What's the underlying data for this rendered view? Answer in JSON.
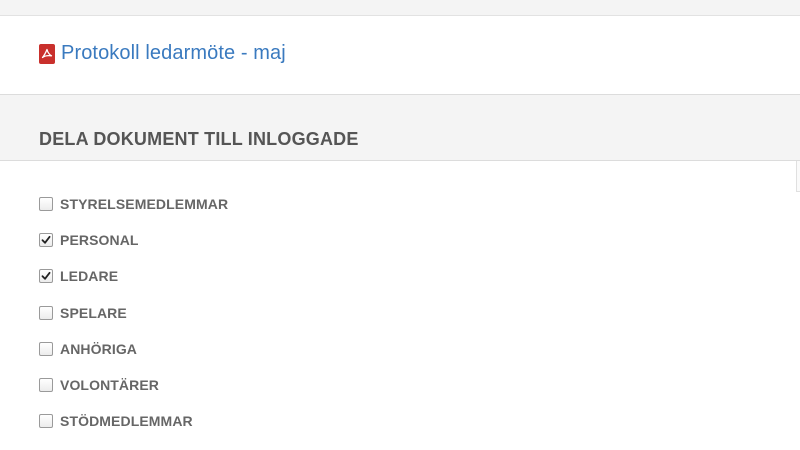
{
  "document": {
    "title": "Protokoll ledarmöte - maj",
    "icon": "pdf-file-icon",
    "icon_color": "#c9302c",
    "link_color": "#3a7abf"
  },
  "share_section": {
    "title": "DELA DOKUMENT TILL INLOGGADE",
    "groups": [
      {
        "label": "STYRELSEMEDLEMMAR",
        "checked": false
      },
      {
        "label": "PERSONAL",
        "checked": true
      },
      {
        "label": "LEDARE",
        "checked": true
      },
      {
        "label": "SPELARE",
        "checked": false
      },
      {
        "label": "ANHÖRIGA",
        "checked": false
      },
      {
        "label": "VOLONTÄRER",
        "checked": false
      },
      {
        "label": "STÖDMEDLEMMAR",
        "checked": false
      }
    ]
  }
}
